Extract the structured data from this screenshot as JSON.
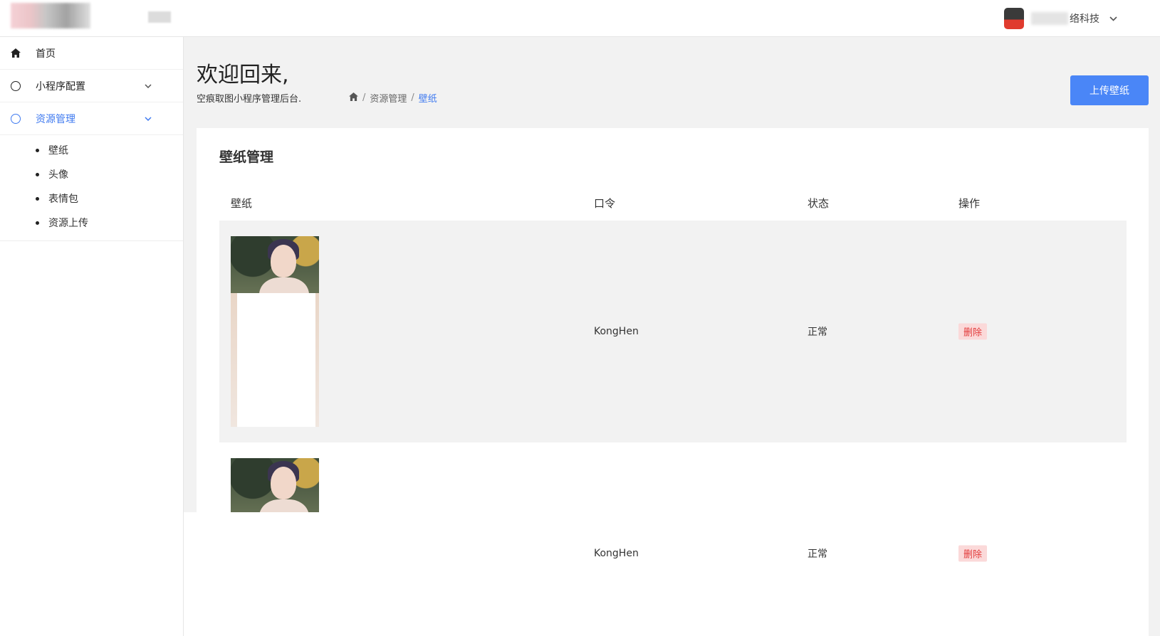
{
  "header": {
    "user_name": "络科技"
  },
  "sidebar": {
    "items": [
      {
        "label": "首页"
      },
      {
        "label": "小程序配置"
      },
      {
        "label": "资源管理"
      }
    ],
    "sub_items": [
      {
        "label": "壁纸"
      },
      {
        "label": "头像"
      },
      {
        "label": "表情包"
      },
      {
        "label": "资源上传"
      }
    ]
  },
  "page": {
    "welcome": "欢迎回来,",
    "subtitle": "空痕取图小程序管理后台.",
    "breadcrumb": [
      "资源管理",
      "壁纸"
    ],
    "breadcrumb_separator": "/",
    "upload_button": "上传壁纸"
  },
  "card": {
    "title": "壁纸管理",
    "columns": [
      "壁纸",
      "口令",
      "状态",
      "操作"
    ],
    "rows": [
      {
        "password": "KongHen",
        "status": "正常",
        "action": "删除"
      },
      {
        "password": "KongHen",
        "status": "正常",
        "action": "删除"
      }
    ]
  },
  "colors": {
    "accent": "#3f7af0",
    "button": "#4a86f7",
    "danger": "#e23b3b",
    "danger_bg": "#fbd9d9"
  }
}
